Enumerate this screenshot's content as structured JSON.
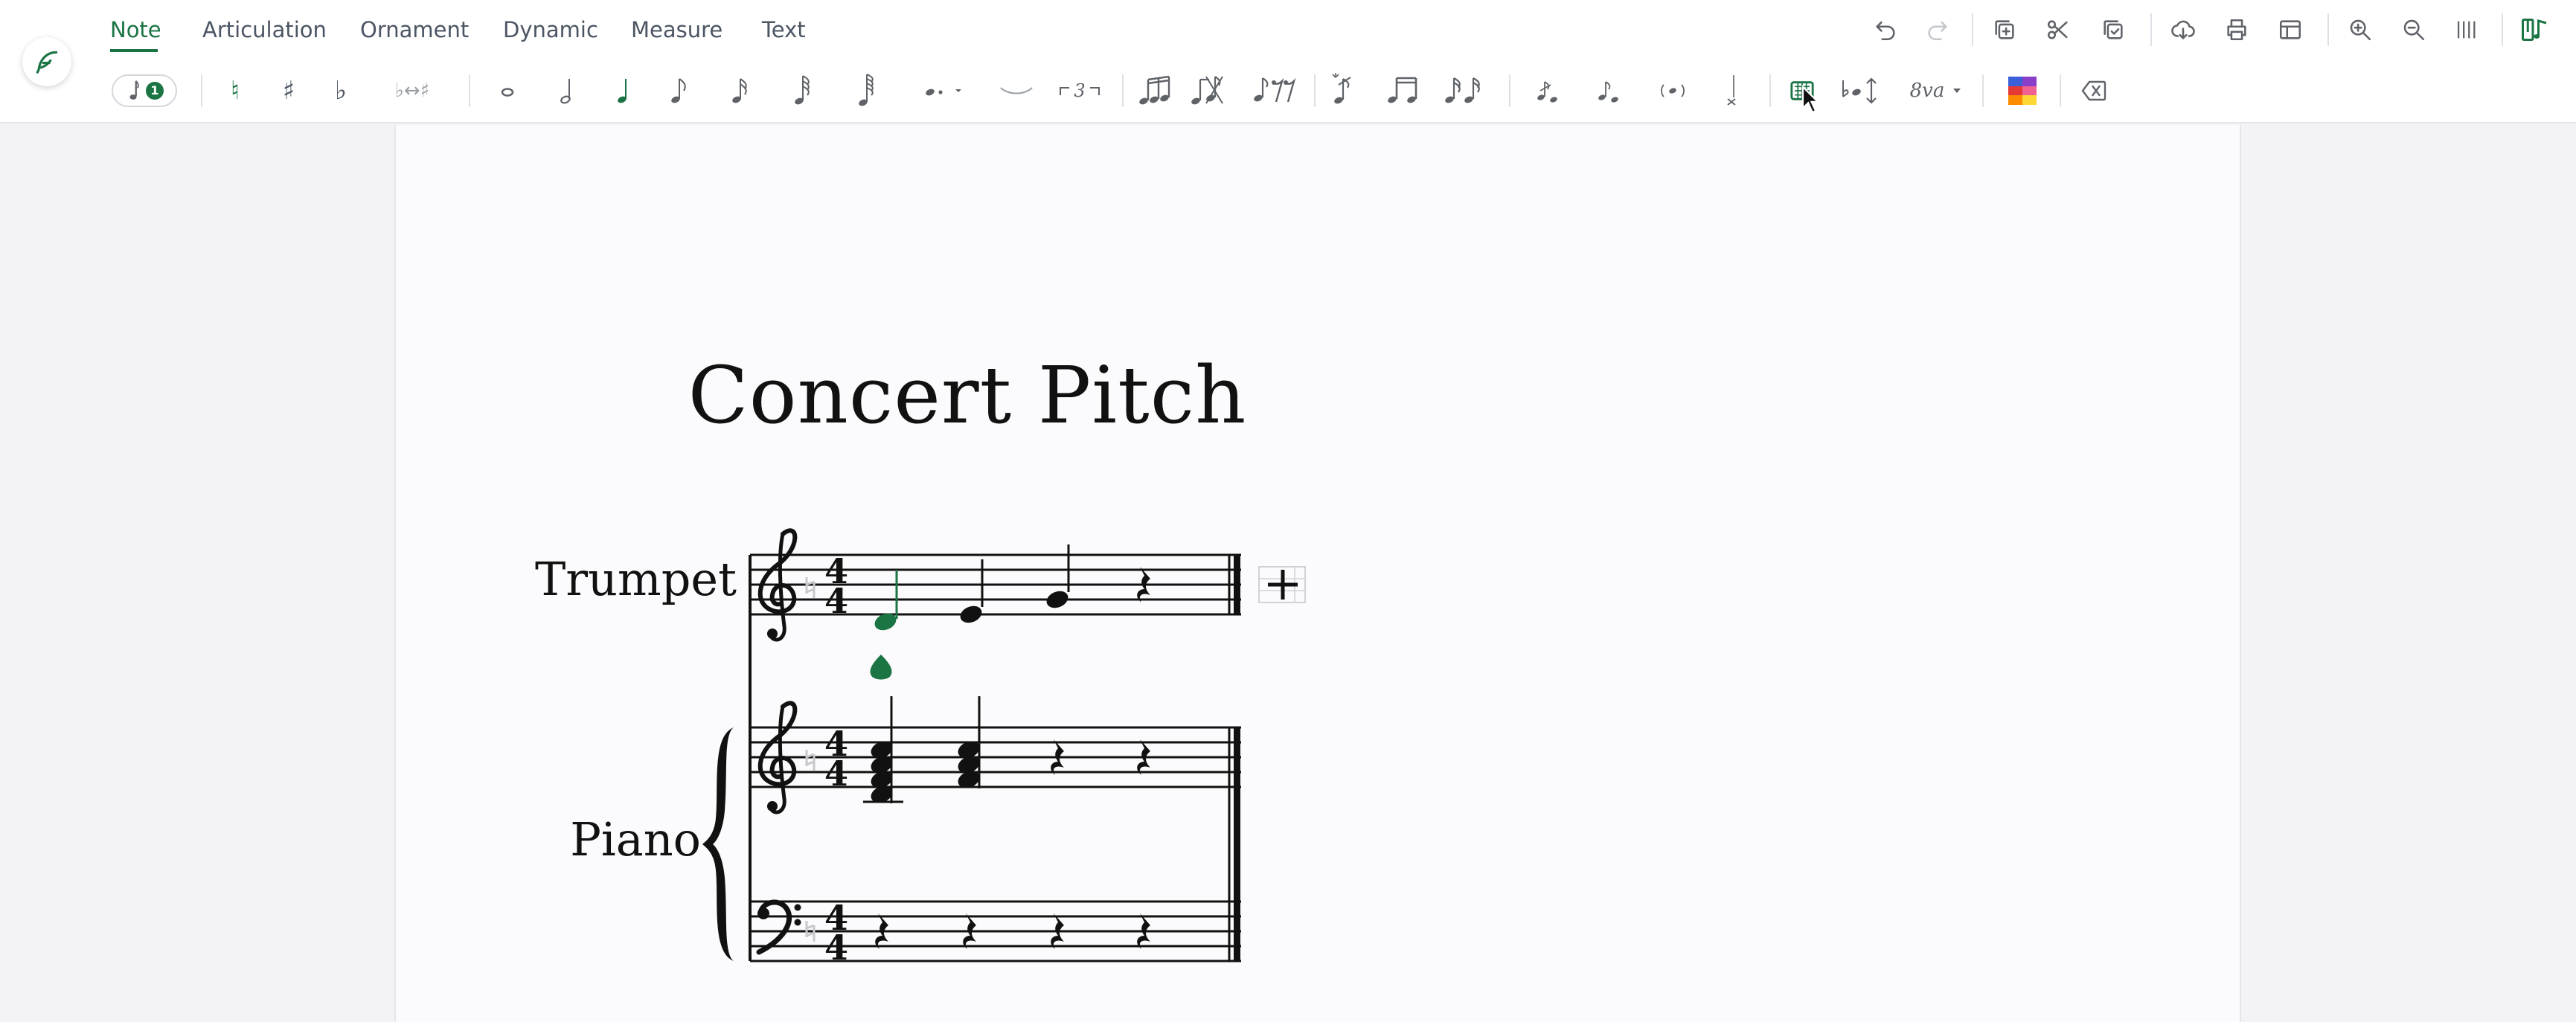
{
  "tabs": [
    {
      "label": "Note",
      "active": true
    },
    {
      "label": "Articulation",
      "active": false
    },
    {
      "label": "Ornament",
      "active": false
    },
    {
      "label": "Dynamic",
      "active": false
    },
    {
      "label": "Measure",
      "active": false
    },
    {
      "label": "Text",
      "active": false
    }
  ],
  "voice_badge": "1",
  "accidentals": {
    "natural": "♮",
    "sharp": "♯",
    "flat": "♭",
    "enharmonic": "♭↔♯"
  },
  "tuplet_label": "3",
  "octave_label": "8va",
  "score": {
    "title": "Concert Pitch",
    "instruments": [
      "Trumpet",
      "Piano"
    ],
    "time_signature": "4/4"
  },
  "colors": {
    "accent": "#1a7444",
    "toolbar_icon": "#5f6368",
    "page_bg": "#fbfbfd",
    "app_bg": "#f3f3f6"
  }
}
